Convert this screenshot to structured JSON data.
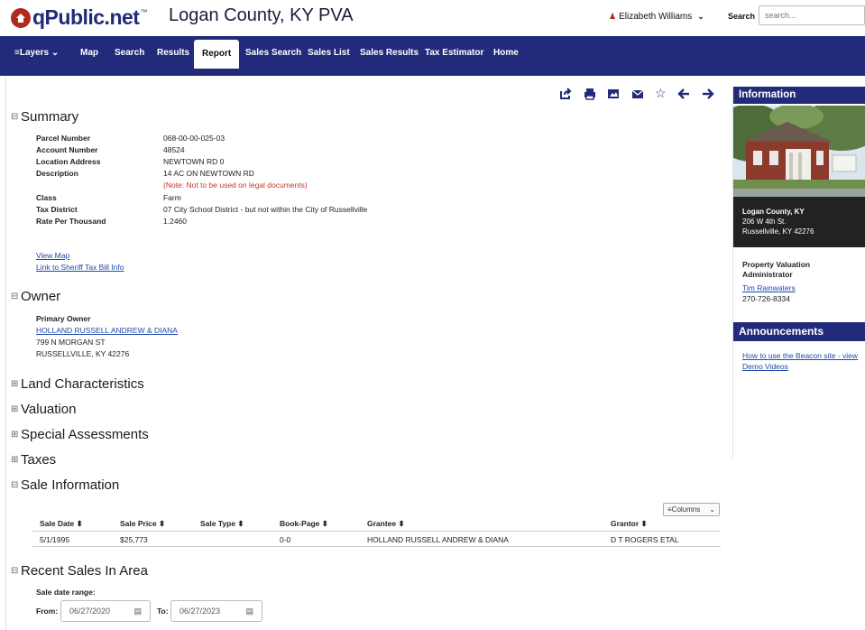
{
  "header": {
    "logo_text": "qPublic.net",
    "logo_tm": "™",
    "county_title": "Logan County, KY PVA",
    "user_name": "Elizabeth Williams",
    "search_label": "Search",
    "search_placeholder": "search..."
  },
  "nav": {
    "layers": "≡Layers",
    "items": [
      "Map",
      "Search",
      "Results",
      "Report",
      "Sales Search",
      "Sales List",
      "Sales Results",
      "Tax Estimator",
      "Home"
    ],
    "active": "Report"
  },
  "toolbar": {
    "icons": [
      "share-icon",
      "print-icon",
      "image-icon",
      "email-icon",
      "star-icon",
      "arrow-left-icon",
      "arrow-right-icon"
    ]
  },
  "summary": {
    "title": "Summary",
    "rows": [
      {
        "k": "Parcel Number",
        "v": "068-00-00-025-03"
      },
      {
        "k": "Account Number",
        "v": "48524"
      },
      {
        "k": "Location Address",
        "v": "NEWTOWN RD 0"
      },
      {
        "k": "Description",
        "v": "14 AC ON NEWTOWN RD"
      }
    ],
    "note": "(Note: Not to be used on legal documents)",
    "rows2": [
      {
        "k": "Class",
        "v": "Farm"
      },
      {
        "k": "Tax District",
        "v": "07 City School District - but not within the City of Russellville"
      },
      {
        "k": "Rate Per Thousand",
        "v": "1.2460"
      }
    ],
    "view_map": "View Map",
    "sheriff_link": "Link to Sheriff Tax Bill Info"
  },
  "owner": {
    "title": "Owner",
    "label": "Primary Owner",
    "name": "HOLLAND RUSSELL ANDREW & DIANA",
    "address1": "799 N MORGAN ST",
    "address2": "RUSSELLVILLE, KY 42276"
  },
  "sections": {
    "land": "Land Characteristics",
    "valuation": "Valuation",
    "special": "Special Assessments",
    "taxes": "Taxes",
    "sale": "Sale Information",
    "recent": "Recent Sales In Area"
  },
  "sale_table": {
    "columns_btn": "≡Columns",
    "headers": [
      "Sale Date ⬍",
      "Sale Price ⬍",
      "Sale Type ⬍",
      "Book-Page ⬍",
      "Grantee ⬍",
      "Grantor ⬍"
    ],
    "rows": [
      [
        "5/1/1995",
        "$25,773",
        "",
        "0-0",
        "HOLLAND RUSSELL ANDREW & DIANA",
        "D T ROGERS ETAL"
      ]
    ]
  },
  "recent": {
    "range_label": "Sale date range:",
    "from_label": "From:",
    "from_value": "06/27/2020",
    "to_label": "To:",
    "to_value": "06/27/2023"
  },
  "sidebar": {
    "info_title": "Information",
    "county": "Logan County, KY",
    "street": "206 W 4th St.",
    "city": "Russellville, KY 42276",
    "pva_label1": "Property Valuation",
    "pva_label2": "Administrator",
    "pva_name": "Tim Rainwaters",
    "phone": "270-726-8334",
    "announce_title": "Announcements",
    "announce_link1": "How to use the Beacon site - view",
    "announce_link2": "Demo Videos"
  }
}
